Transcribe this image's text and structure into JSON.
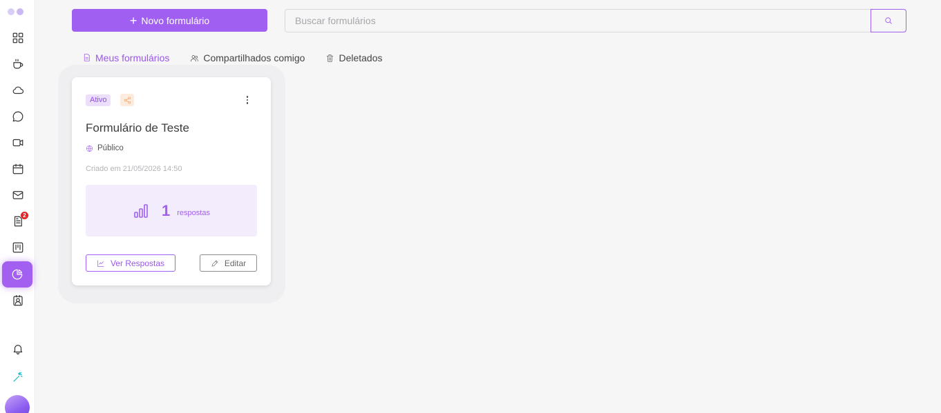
{
  "toolbar": {
    "new_form_label": "Novo formulário",
    "search_placeholder": "Buscar formulários"
  },
  "sidebar": {
    "items": [
      {
        "icon": "grid-icon"
      },
      {
        "icon": "coffee-cup-icon"
      },
      {
        "icon": "cloud-icon"
      },
      {
        "icon": "chat-bubble-icon"
      },
      {
        "icon": "video-camera-icon"
      },
      {
        "icon": "calendar-icon"
      },
      {
        "icon": "mail-icon"
      },
      {
        "icon": "document-icon",
        "badge": "2"
      },
      {
        "icon": "kanban-board-icon"
      },
      {
        "icon": "pie-chart-icon",
        "active": true
      },
      {
        "icon": "contact-card-icon"
      },
      {
        "icon": "bell-icon"
      },
      {
        "icon": "magic-wand-icon"
      }
    ]
  },
  "tabs": [
    {
      "label": "Meus formulários",
      "active": true,
      "icon": "document-icon"
    },
    {
      "label": "Compartilhados comigo",
      "active": false,
      "icon": "users-icon"
    },
    {
      "label": "Deletados",
      "active": false,
      "icon": "trash-icon"
    }
  ],
  "form_card": {
    "status": "Ativo",
    "title": "Formulário de Teste",
    "visibility": "Público",
    "created": "Criado em 21/05/2026 14:50",
    "response_count": "1",
    "response_unit": "respostas",
    "view_responses_label": "Ver Respostas",
    "edit_label": "Editar"
  },
  "colors": {
    "accent": "#a05ff0",
    "badge": "#e12424",
    "share_bg": "#fdebdd",
    "share_icon": "#f0a06a"
  }
}
